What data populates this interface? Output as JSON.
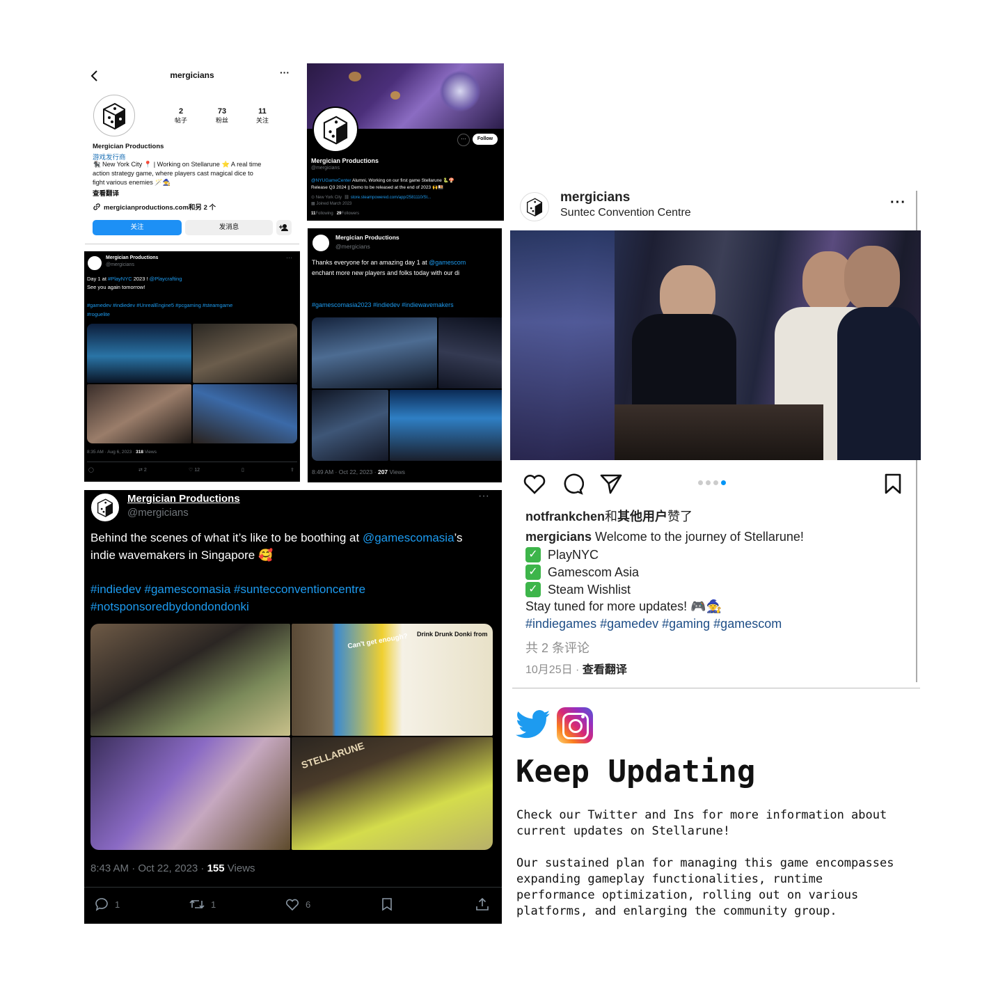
{
  "ig_profile": {
    "username": "mergicians",
    "stats": [
      {
        "value": "2",
        "label": "帖子"
      },
      {
        "value": "73",
        "label": "粉丝"
      },
      {
        "value": "11",
        "label": "关注"
      }
    ],
    "name": "Mergician Productions",
    "category": "游戏发行商",
    "bio_line1": "🐈‍⬛ New York City 📍 | Working on Stellarune ⭐ A real time",
    "bio_line2": "action strategy game, where players cast magical dice to",
    "bio_line3": "fight various enemies 🪄🧙",
    "translate": "查看翻译",
    "link": "mergicianproductions.com和另 2 个",
    "follow_btn": "关注",
    "message_btn": "发消息"
  },
  "tw_profile": {
    "name": "Mergician Productions",
    "handle": "@mergicians",
    "follow_btn": "Follow",
    "bio_mention": "@NYUGameCenter",
    "bio_rest": " Alumni, Working on our first game Stellarune 🐍🍄",
    "bio_line2": "Release Q3 2024 || Demo to be released at the end of 2023 🙌🍱",
    "location": "New York City",
    "url": "store.steampowered.com/app/2581110/St...",
    "joined": "Joined March 2023",
    "following_count": "11",
    "following_label": "Following",
    "followers_count": "29",
    "followers_label": "Followers"
  },
  "tweet1": {
    "name": "Mergician Productions",
    "handle": "@mergicians",
    "text_a": "Day 1 at ",
    "tag_playnyc": "#PlayNYC",
    "text_b": " 2023 ! ",
    "mention": "@Playcrafting",
    "text_c": "See you again tomorrow!",
    "hashtags1": "#gamedev #indiedev #UnrealEngine5 #pcgaming #steamgame",
    "hashtags2": "#roguelite",
    "meta": "8:35 AM · Aug 6, 2023 · ",
    "views_count": "318",
    "views_label": " Views",
    "retweets": "2",
    "likes": "12"
  },
  "tweet2": {
    "name": "Mergician Productions",
    "handle": "@mergicians",
    "text_a": "Thanks everyone for an amazing day 1 at ",
    "mention": "@gamescom",
    "text_b": "enchant more new players and folks today with our di",
    "hashtags": "#gamescomasia2023 #indiedev #indiewavemakers",
    "meta": "8:49 AM · Oct 22, 2023 · ",
    "views_count": "207",
    "views_label": " Views"
  },
  "tweet3": {
    "name": "Mergician Productions",
    "handle": "@mergicians",
    "text_a": "Behind the scenes of what it’s like to be boothing at ",
    "mention": "@gamescomasia",
    "text_b": "’s",
    "text_c": "indie wavemakers in Singapore 🥰",
    "hashtags1": "#indiedev #gamescomasia #suntecconventioncentre",
    "hashtags2": "#notsponsoredbydondondonki",
    "meta": "8:43 AM · Oct 22, 2023 · ",
    "views_count": "155",
    "views_label": " Views",
    "replies": "1",
    "retweets": "1",
    "likes": "6",
    "sign1": "Can't get enough?",
    "sign2": "Drink Drunk Donki from",
    "sign3": "STELLARUNE"
  },
  "ig_post": {
    "username": "mergicians",
    "location": "Suntec Convention Centre",
    "liked_user": "notfrankchen",
    "liked_rest_a": "和",
    "liked_rest_b": "其他用户",
    "liked_rest_c": "赞了",
    "caption_user": "mergicians",
    "caption": " Welcome to the journey of Stellarune!",
    "check1": "PlayNYC",
    "check2": "Gamescom Asia",
    "check3": "Steam Wishlist",
    "stay": "Stay tuned for more updates! 🎮🧙",
    "hashtags": "#indiegames #gamedev #gaming #gamescom",
    "comments": "共 2 条评论",
    "date": "10月25日",
    "dot": " · ",
    "translate": "查看翻译"
  },
  "footer": {
    "title": "Keep Updating",
    "p1_line1": "Check our Twitter and Ins for more information about",
    "p1_line2": "current updates on Stellarune!",
    "p2_line1": "Our sustained plan for managing this game encompasses",
    "p2_line2": "expanding gameplay functionalities, runtime",
    "p2_line3": "performance optimization, rolling out on various",
    "p2_line4": "platforms, and enlarging the community group."
  },
  "colors": {
    "twitter_blue": "#1d9bf0",
    "ig_blue": "#0095f6",
    "link_blue": "#00376b"
  },
  "icons": [
    "back-icon",
    "more-icon",
    "dice-logo-icon",
    "link-icon",
    "add-person-icon",
    "reply-icon",
    "retweet-icon",
    "like-icon",
    "bookmark-icon",
    "share-icon",
    "heart-icon",
    "comment-icon",
    "send-icon",
    "save-icon",
    "twitter-icon",
    "instagram-icon",
    "check-icon"
  ]
}
